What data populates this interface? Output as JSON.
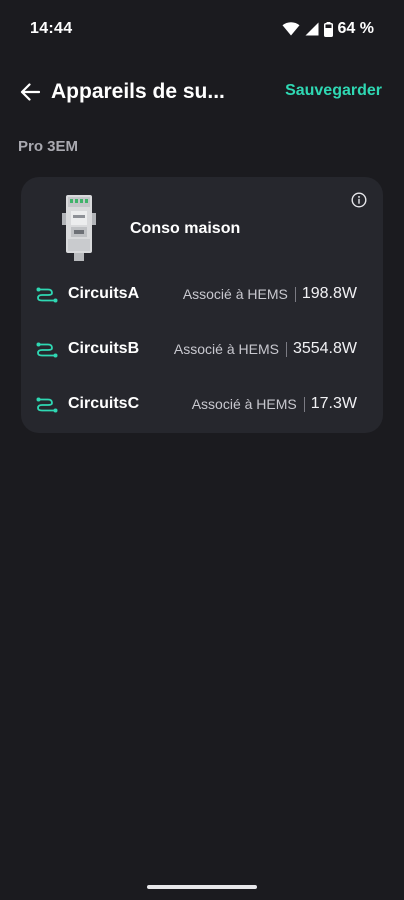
{
  "status_bar": {
    "time": "14:44",
    "battery": "64 %"
  },
  "header": {
    "title": "Appareils de su...",
    "save_label": "Sauvegarder"
  },
  "section": {
    "label": "Pro 3EM"
  },
  "device": {
    "name": "Conso maison"
  },
  "circuits": [
    {
      "name": "CircuitsA",
      "status": "Associé à HEMS",
      "power": "198.8W"
    },
    {
      "name": "CircuitsB",
      "status": "Associé à HEMS",
      "power": "3554.8W"
    },
    {
      "name": "CircuitsC",
      "status": "Associé à HEMS",
      "power": "17.3W"
    }
  ],
  "colors": {
    "accent": "#2fd8b3",
    "background": "#1b1b1f",
    "card": "#26272d"
  },
  "icons": {
    "back": "arrow-left-icon",
    "info": "info-icon",
    "circuit": "circuit-icon",
    "wifi": "wifi-icon",
    "signal": "signal-icon",
    "battery": "battery-icon"
  }
}
